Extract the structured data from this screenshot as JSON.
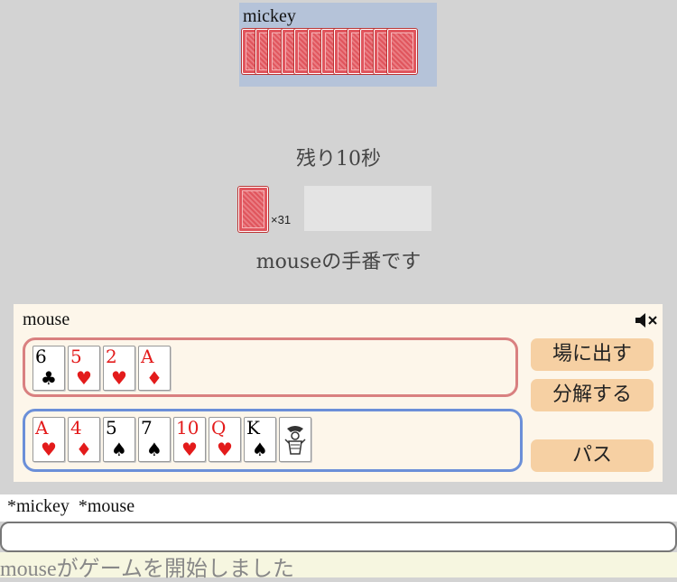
{
  "opponent": {
    "name": "mickey",
    "card_count": 12
  },
  "table": {
    "timer_text": "残り10秒",
    "deck_count_text": "×31",
    "turn_message": "mouseの手番です"
  },
  "player": {
    "name": "mouse",
    "mute_icon": "speaker-muted-icon",
    "selected_cards": [
      {
        "rank": "6",
        "suit": "♣",
        "color": "black"
      },
      {
        "rank": "5",
        "suit": "♥",
        "color": "red"
      },
      {
        "rank": "2",
        "suit": "♥",
        "color": "red"
      },
      {
        "rank": "A",
        "suit": "♦",
        "color": "red"
      }
    ],
    "hand_cards": [
      {
        "rank": "A",
        "suit": "♥",
        "color": "red"
      },
      {
        "rank": "4",
        "suit": "♦",
        "color": "red"
      },
      {
        "rank": "5",
        "suit": "♠",
        "color": "black"
      },
      {
        "rank": "7",
        "suit": "♠",
        "color": "black"
      },
      {
        "rank": "10",
        "suit": "♥",
        "color": "red"
      },
      {
        "rank": "Q",
        "suit": "♥",
        "color": "red"
      },
      {
        "rank": "K",
        "suit": "♠",
        "color": "black"
      },
      {
        "rank": "",
        "suit": "",
        "color": "black",
        "joker": true
      }
    ],
    "buttons": {
      "play": "場に出す",
      "split": "分解する",
      "pass": "パス"
    }
  },
  "players_line": "*mickey  *mouse",
  "chat": {
    "value": "",
    "placeholder": ""
  },
  "log_message": "mouseがゲームを開始しました",
  "colors": {
    "selected_border": "#d98080",
    "hand_border": "#6b8fd8",
    "button_bg": "#f6d0a3",
    "card_red": "#e31b1b"
  }
}
